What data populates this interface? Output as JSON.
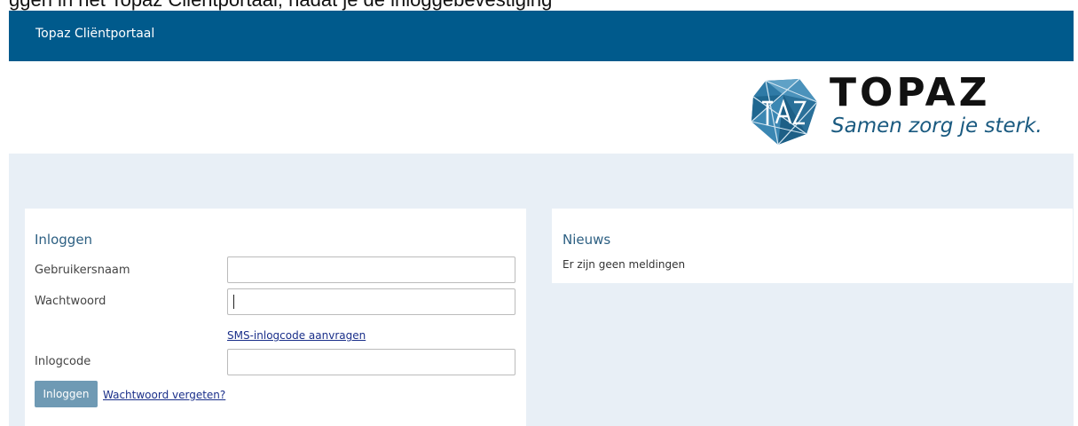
{
  "top_text": "ggen in het Topaz Cliëntportaal, nadat je de inloggebevestiging",
  "navbar": {
    "brand": "Topaz Cliëntportaal"
  },
  "logo": {
    "title": "TOPAZ",
    "tagline": "Samen zorg je sterk.",
    "icon": "topaz-diamond-logo"
  },
  "login": {
    "title": "Inloggen",
    "username_label": "Gebruikersnaam",
    "username_value": "",
    "password_label": "Wachtwoord",
    "sms_link": "SMS-inlogcode aanvragen",
    "code_label": "Inlogcode",
    "submit_label": "Inloggen",
    "forgot_link": "Wachtwoord vergeten?"
  },
  "news": {
    "title": "Nieuws",
    "empty_message": "Er zijn geen meldingen"
  },
  "colors": {
    "navbar": "#005a8c",
    "content_bg": "#e8eff6",
    "button": "#6f9ab4",
    "tagline": "#1a5a80",
    "link": "#1a2f8a"
  }
}
